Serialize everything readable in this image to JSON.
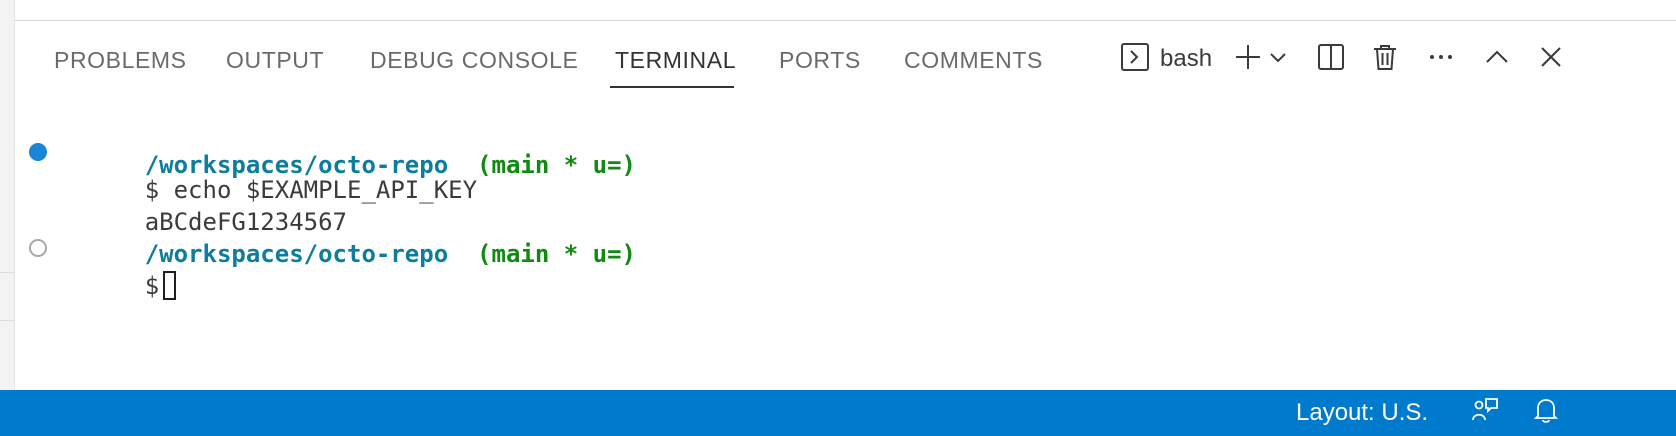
{
  "panel": {
    "tabs": [
      {
        "label": "PROBLEMS"
      },
      {
        "label": "OUTPUT"
      },
      {
        "label": "DEBUG CONSOLE"
      },
      {
        "label": "TERMINAL"
      },
      {
        "label": "PORTS"
      },
      {
        "label": "COMMENTS"
      }
    ],
    "active_tab": "TERMINAL",
    "actions": {
      "terminal_name": "bash",
      "icons": [
        "terminal-icon",
        "plus-icon",
        "chevron-down-icon",
        "split-icon",
        "trash-icon",
        "ellipsis-icon",
        "chevron-up-icon",
        "close-icon"
      ]
    }
  },
  "terminal": {
    "lines": [
      {
        "path": "/workspaces/octo-repo",
        "branch": "(main * u=)"
      },
      {
        "prompt": "$",
        "command": "echo $EXAMPLE_API_KEY",
        "decoration": "success"
      },
      {
        "output": "aBCdeFG1234567"
      },
      {
        "path": "/workspaces/octo-repo",
        "branch": "(main * u=)"
      },
      {
        "prompt": "$",
        "command": "",
        "decoration": "empty"
      }
    ]
  },
  "statusbar": {
    "layout": "Layout: U.S.",
    "icons": [
      "feedback-icon",
      "bell-icon"
    ]
  },
  "colors": {
    "statusbar": "#007acc",
    "path": "#0c7d9d",
    "branch": "#108a10",
    "decoration_success": "#1a85d6"
  }
}
